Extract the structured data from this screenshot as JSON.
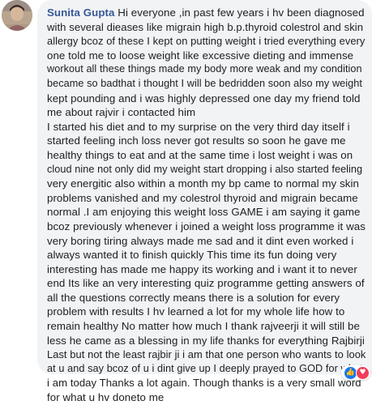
{
  "comment": {
    "author": "Sunita Gupta",
    "lines": [
      "Hi everyone ,in past few years i hv been diagnosed",
      "with several dieases like migrain high b.p.thyroid colestrol and skin",
      "allergy bcoz of these I kept on putting weight i tried everything every",
      "one told me to loose weight like excessive dieting and immense",
      "workout all these things made my body more weak and my condition",
      "became so badthat i thought I will be bedridden soon also my weight",
      "kept pounding and i was highly depressed one day my friend told",
      "me about rajvir i contacted him",
      "I started his diet and to my surprise on the very third day itself i",
      "started feeling inch loss never got results so soon he gave me",
      "healthy things to eat and at the same time i lost weight i was on",
      "cloud nine not only did my weight start dropping i also started feeling",
      "very energitic also within a month my bp came to normal my skin",
      "problems vanished and my colestrol thyroid and migrain became",
      "normal .I am enjoying this weight loss GAME i am saying it game",
      "bcoz previously whenever i joined a weight loss programme it was",
      "very boring tiring always made me sad and it dint even worked i",
      "always wanted it to finish quickly This time its fun doing very",
      "interesting has made me happy its working and i want it to never",
      "end Its like an very interesting quiz programme getting answers of",
      "all the questions correctly means there is a solution for every",
      "problem with results I hv learned a lot for my whole life how to",
      "remain healthy No matter how much I thank rajveerji it will still be",
      "less he came as a blessing in my life thanks for everything Rajbirji",
      "Last but not the least rajbir ji i am that one person who wants to look",
      "at u and say bcoz of u i dint give up I deeply prayed to GOD for what",
      "i am today Thanks a lot again. Though thanks is a very small word",
      "for what u hv doneto me"
    ]
  },
  "reactions": {
    "like_icon": "thumbs-up-icon",
    "love_icon": "heart-icon",
    "like_glyph": "👍",
    "love_glyph": "♥"
  },
  "colors": {
    "author": "#385898",
    "bubble": "#f2f3f5",
    "text": "#1c1e21",
    "like": "#1877f2",
    "love": "#f33e58"
  }
}
